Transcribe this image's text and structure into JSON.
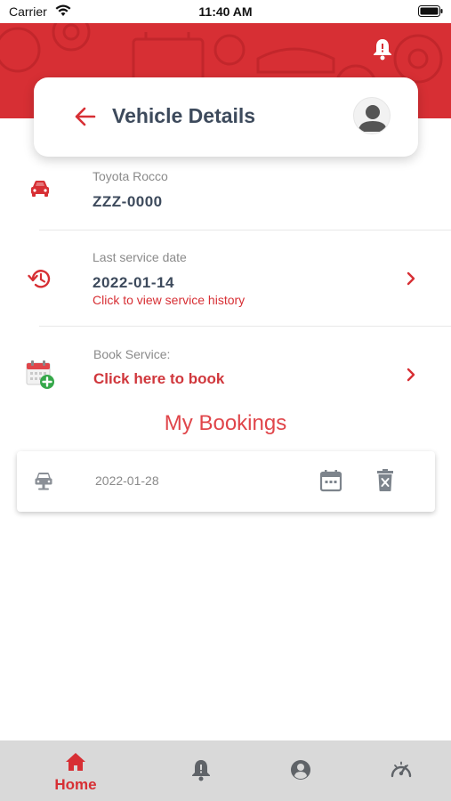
{
  "status_bar": {
    "carrier": "Carrier",
    "time": "11:40 AM"
  },
  "header": {
    "title": "Vehicle Details",
    "icons": [
      "back-arrow-icon",
      "user-avatar-icon",
      "notification-bell-icon"
    ]
  },
  "vehicle": {
    "model": "Toyota Rocco",
    "plate": "ZZZ-0000",
    "icon": "car-icon"
  },
  "service": {
    "label": "Last service date",
    "date": "2022-01-14",
    "link": "Click to view service history",
    "icon": "history-icon"
  },
  "book": {
    "label": "Book Service:",
    "link": "Click here to book",
    "icon": "calendar-add-icon"
  },
  "bookings": {
    "title": "My Bookings",
    "items": [
      {
        "date": "2022-01-28",
        "icons": [
          "car-front-icon",
          "calendar-icon",
          "delete-icon"
        ]
      }
    ]
  },
  "tab_bar": {
    "active_label": "Home",
    "tabs": [
      "home-icon",
      "notification-bell-icon",
      "account-icon",
      "service-gauge-icon"
    ]
  },
  "colors": {
    "brand_red": "#d72f34",
    "text_dark": "#3d4a5c",
    "text_muted": "#8a8a8a",
    "tab_bar_bg": "#d9d9d9"
  }
}
